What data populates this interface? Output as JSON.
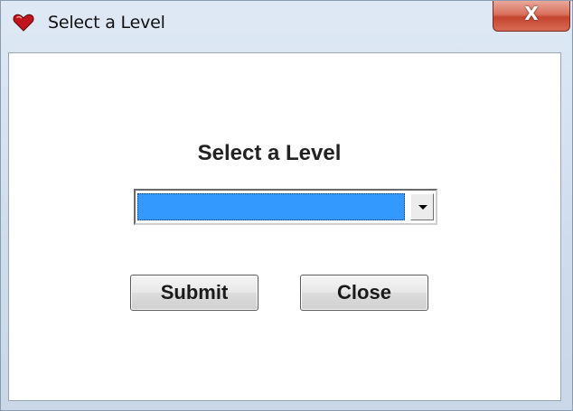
{
  "window": {
    "title": "Select a Level",
    "close_glyph": "X"
  },
  "dialog": {
    "heading": "Select a Level",
    "level_select": {
      "selected_value": "",
      "options": []
    },
    "buttons": {
      "submit_label": "Submit",
      "close_label": "Close"
    }
  },
  "icons": {
    "title_icon": "heart-icon",
    "dropdown_arrow": "chevron-down-icon"
  },
  "colors": {
    "title_icon": "#c0141c",
    "close_button": "#c4452f",
    "selection_highlight": "#3399ff"
  }
}
